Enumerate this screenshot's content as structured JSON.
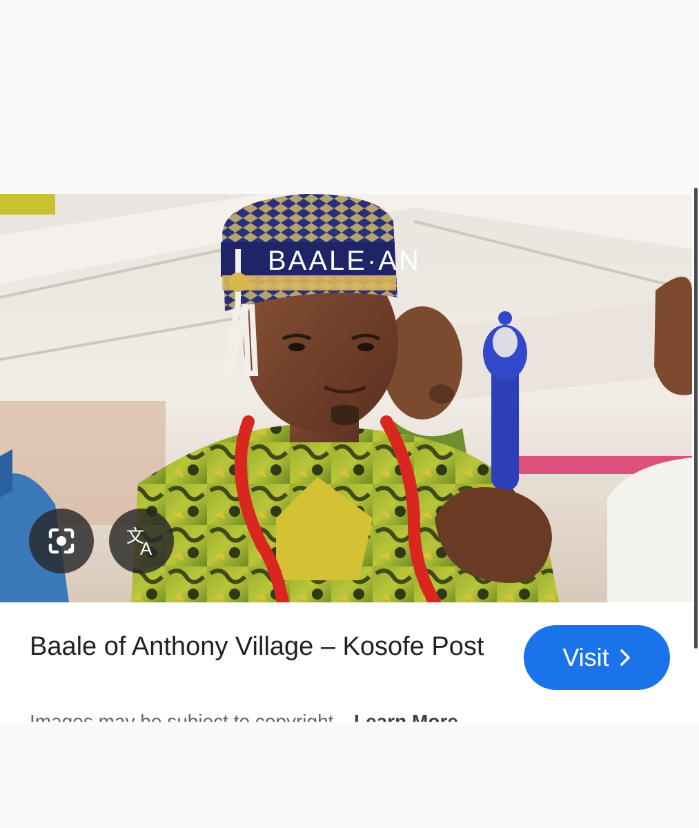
{
  "result": {
    "title": "Baale of Anthony Village – Kosofe Post",
    "visit_label": "Visit",
    "cap_text": "BAALE·AN",
    "copyright_notice": "Images may be subject to copyright.",
    "learn_more_label": "Learn More"
  },
  "actions": {
    "lens_icon": "camera-lens-icon",
    "translate_icon": "translate-icon",
    "visit_icon": "chevron-right-icon"
  },
  "colors": {
    "accent": "#1a73e8",
    "title_text": "#202124",
    "muted_text": "#5f6368"
  }
}
